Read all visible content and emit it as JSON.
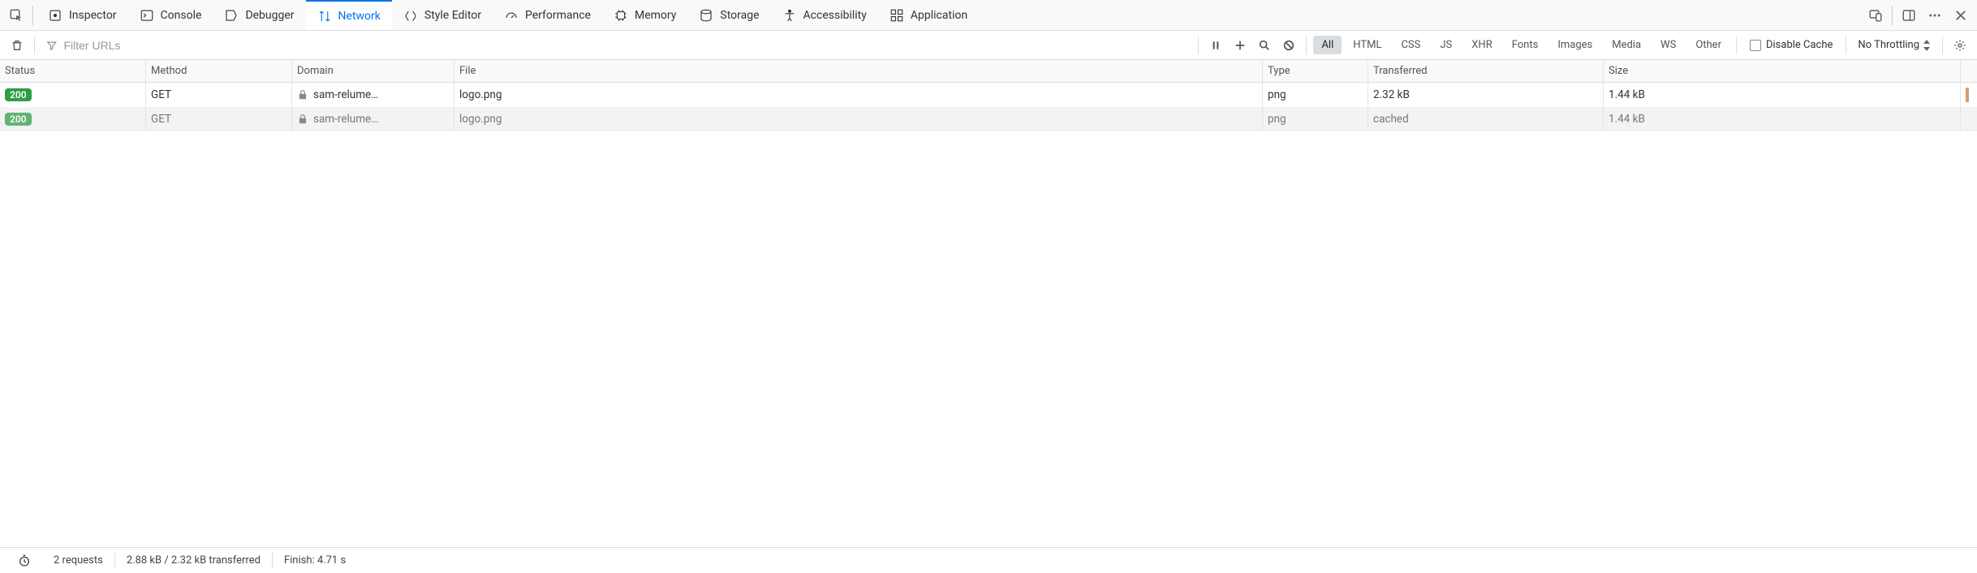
{
  "tabs": [
    {
      "label": "Inspector"
    },
    {
      "label": "Console"
    },
    {
      "label": "Debugger"
    },
    {
      "label": "Network",
      "active": true
    },
    {
      "label": "Style Editor"
    },
    {
      "label": "Performance"
    },
    {
      "label": "Memory"
    },
    {
      "label": "Storage"
    },
    {
      "label": "Accessibility"
    },
    {
      "label": "Application"
    }
  ],
  "toolbar": {
    "filter_placeholder": "Filter URLs",
    "type_filters": [
      "All",
      "HTML",
      "CSS",
      "JS",
      "XHR",
      "Fonts",
      "Images",
      "Media",
      "WS",
      "Other"
    ],
    "active_type_filter": "All",
    "disable_cache_label": "Disable Cache",
    "throttling_label": "No Throttling"
  },
  "table": {
    "headers": {
      "status": "Status",
      "method": "Method",
      "domain": "Domain",
      "file": "File",
      "type": "Type",
      "transferred": "Transferred",
      "size": "Size"
    },
    "rows": [
      {
        "status": "200",
        "method": "GET",
        "domain": "sam-relume…",
        "file": "logo.png",
        "type": "png",
        "transferred": "2.32 kB",
        "size": "1.44 kB",
        "cached": false
      },
      {
        "status": "200",
        "method": "GET",
        "domain": "sam-relume…",
        "file": "logo.png",
        "type": "png",
        "transferred": "cached",
        "size": "1.44 kB",
        "cached": true
      }
    ]
  },
  "status_bar": {
    "requests": "2 requests",
    "transferred": "2.88 kB / 2.32 kB transferred",
    "finish": "Finish: 4.71 s"
  }
}
